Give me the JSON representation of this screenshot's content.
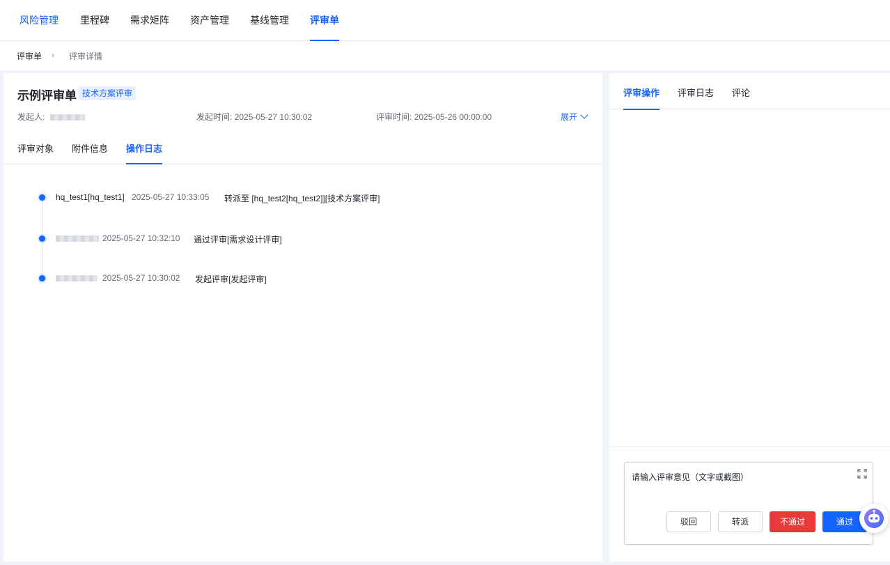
{
  "topnav": {
    "items": [
      {
        "label": "风险管理"
      },
      {
        "label": "里程碑"
      },
      {
        "label": "需求矩阵"
      },
      {
        "label": "资产管理"
      },
      {
        "label": "基线管理"
      },
      {
        "label": "评审单"
      }
    ]
  },
  "breadcrumb": {
    "root": "评审单",
    "separator": "›",
    "current": "评审详情"
  },
  "review": {
    "title": "示例评审单",
    "tag": "技术方案评审",
    "initiator_label": "发起人:",
    "start_time_label": "发起时间:",
    "start_time": "2025-05-27 10:30:02",
    "review_time_label": "评审时间:",
    "review_time": "2025-05-26 00:00:00",
    "expand_label": "展开"
  },
  "subtabs": [
    {
      "label": "评审对象"
    },
    {
      "label": "附件信息"
    },
    {
      "label": "操作日志"
    }
  ],
  "logs": [
    {
      "who": "hq_test1[hq_test1]",
      "time": "2025-05-27 10:33:05",
      "action": "转派至 [hq_test2[hq_test2]][技术方案评审]"
    },
    {
      "who": "",
      "time": "2025-05-27 10:32:10",
      "action": "通过评审[需求设计评审]"
    },
    {
      "who": "",
      "time": "2025-05-27 10:30:02",
      "action": "发起评审[发起评审]"
    }
  ],
  "right_tabs": [
    {
      "label": "评审操作"
    },
    {
      "label": "评审日志"
    },
    {
      "label": "评论"
    }
  ],
  "comment": {
    "placeholder": "请输入评审意见（文字或截图）"
  },
  "actions": {
    "reject": "驳回",
    "transfer": "转派",
    "fail": "不通过",
    "pass": "通过"
  },
  "colors": {
    "accent": "#1664ff",
    "danger": "#e83a3a"
  },
  "icons": {
    "fullscreen": "expand-icon",
    "assistant": "robot-icon"
  }
}
